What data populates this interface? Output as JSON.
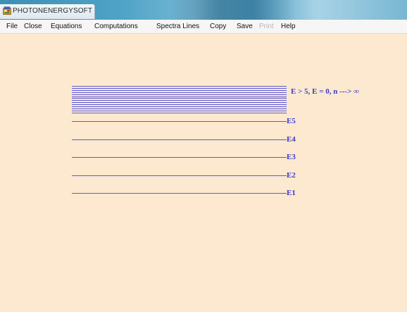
{
  "window": {
    "title": "PHOTONENERGYSOFT",
    "icon": "app-icon",
    "background_color": "#fde9cf"
  },
  "menu": {
    "items": [
      {
        "label": "File",
        "enabled": true
      },
      {
        "label": "Close",
        "enabled": true
      },
      {
        "label": "Equations",
        "enabled": true
      },
      {
        "label": "Computations",
        "enabled": true
      },
      {
        "label": "Spectra Lines",
        "enabled": true
      },
      {
        "label": "Copy",
        "enabled": true
      },
      {
        "label": "Save",
        "enabled": true
      },
      {
        "label": "Print",
        "enabled": false
      },
      {
        "label": "Help",
        "enabled": true
      }
    ]
  },
  "diagram": {
    "line_color": "#5b5bd6",
    "label_color": "#3b3bc8",
    "continuum_label": "E > 5, E = 0, n ---> ∞",
    "levels": [
      {
        "label": "E5"
      },
      {
        "label": "E4"
      },
      {
        "label": "E3"
      },
      {
        "label": "E2"
      },
      {
        "label": "E1"
      }
    ]
  }
}
